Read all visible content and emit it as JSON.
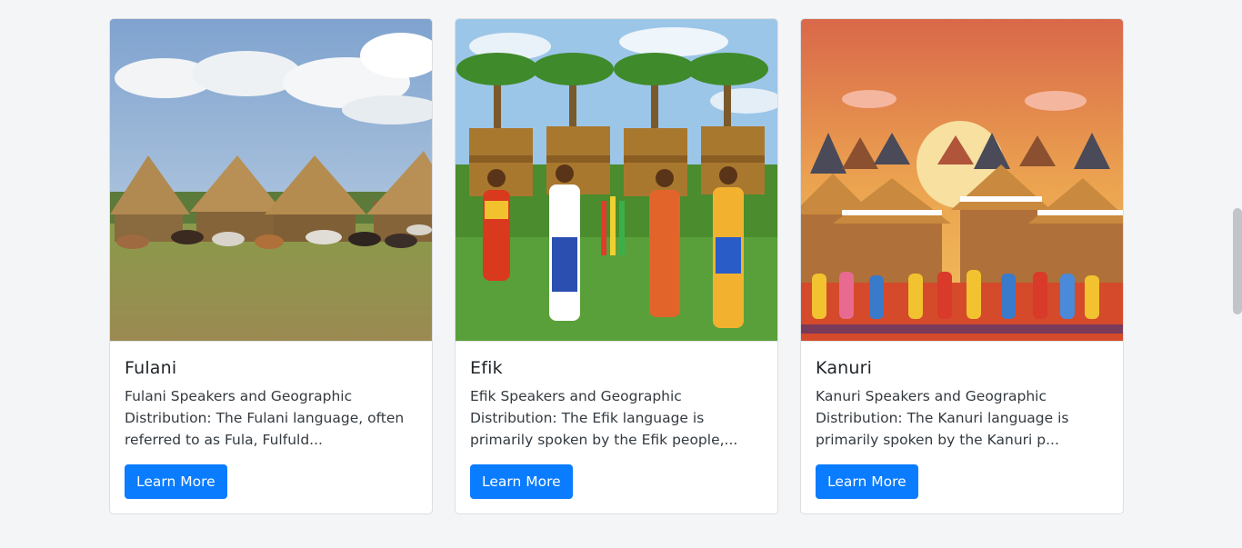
{
  "cards": [
    {
      "title": "Fulani",
      "description": "Fulani Speakers and Geographic Distribution: The Fulani language, often referred to as Fula, Fulfuld...",
      "button_label": "Learn More"
    },
    {
      "title": "Efik",
      "description": "Efik Speakers and Geographic Distribution: The Efik language is primarily spoken by the Efik people,...",
      "button_label": "Learn More"
    },
    {
      "title": "Kanuri",
      "description": "Kanuri Speakers and Geographic Distribution: The Kanuri language is primarily spoken by the Kanuri p...",
      "button_label": "Learn More"
    }
  ],
  "colors": {
    "accent": "#0a7cff",
    "background": "#f4f5f7",
    "card": "#ffffff"
  }
}
